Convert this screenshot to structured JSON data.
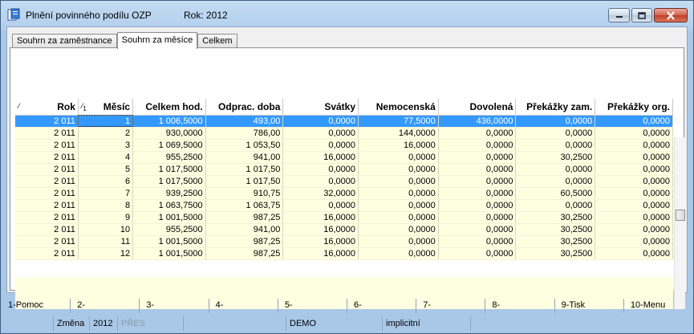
{
  "window": {
    "title": "Plnění povinného podílu OZP",
    "year_label": "Rok: 2012"
  },
  "tabs": [
    {
      "label": "Souhrn za zaměstnance",
      "active": false
    },
    {
      "label": "Souhrn za měsíce",
      "active": true
    },
    {
      "label": "Celkem",
      "active": false
    }
  ],
  "table": {
    "sort_markers": {
      "rok": "⁄",
      "mesic": "⁄"
    },
    "sort_index": "1",
    "columns": [
      "Rok",
      "Měsíc",
      "Celkem hod.",
      "Odprac. doba",
      "Svátky",
      "Nemocenská",
      "Dovolená",
      "Překážky zam.",
      "Překážky org."
    ],
    "rows": [
      [
        "2 011",
        "1",
        "1 006,5000",
        "493,00",
        "0,0000",
        "77,5000",
        "436,0000",
        "0,0000",
        "0,0000"
      ],
      [
        "2 011",
        "2",
        "930,0000",
        "786,00",
        "0,0000",
        "144,0000",
        "0,0000",
        "0,0000",
        "0,0000"
      ],
      [
        "2 011",
        "3",
        "1 069,5000",
        "1 053,50",
        "0,0000",
        "16,0000",
        "0,0000",
        "0,0000",
        "0,0000"
      ],
      [
        "2 011",
        "4",
        "955,2500",
        "941,00",
        "16,0000",
        "0,0000",
        "0,0000",
        "30,2500",
        "0,0000"
      ],
      [
        "2 011",
        "5",
        "1 017,5000",
        "1 017,50",
        "0,0000",
        "0,0000",
        "0,0000",
        "0,0000",
        "0,0000"
      ],
      [
        "2 011",
        "6",
        "1 017,5000",
        "1 017,50",
        "0,0000",
        "0,0000",
        "0,0000",
        "0,0000",
        "0,0000"
      ],
      [
        "2 011",
        "7",
        "939,2500",
        "910,75",
        "32,0000",
        "0,0000",
        "0,0000",
        "60,5000",
        "0,0000"
      ],
      [
        "2 011",
        "8",
        "1 063,7500",
        "1 063,75",
        "0,0000",
        "0,0000",
        "0,0000",
        "0,0000",
        "0,0000"
      ],
      [
        "2 011",
        "9",
        "1 001,5000",
        "987,25",
        "16,0000",
        "0,0000",
        "0,0000",
        "30,2500",
        "0,0000"
      ],
      [
        "2 011",
        "10",
        "955,2500",
        "941,00",
        "16,0000",
        "0,0000",
        "0,0000",
        "30,2500",
        "0,0000"
      ],
      [
        "2 011",
        "11",
        "1 001,5000",
        "987,25",
        "16,0000",
        "0,0000",
        "0,0000",
        "30,2500",
        "0,0000"
      ],
      [
        "2 011",
        "12",
        "1 001,5000",
        "987,25",
        "16,0000",
        "0,0000",
        "0,0000",
        "30,2500",
        "0,0000"
      ]
    ],
    "selected_row": 0
  },
  "function_keys": [
    "1-Pomoc",
    "2-",
    "3-",
    "4-",
    "5-",
    "6-",
    "7-",
    "8-",
    "9-Tisk",
    "10-Menu"
  ],
  "status": {
    "mode": "Změna",
    "year": "2012",
    "pres": "PŘES",
    "company": "DEMO",
    "profile": "implicitní"
  },
  "colors": {
    "selection": "#3399ff",
    "row_background": "#fefee1",
    "title_gradient": "#b5d1ee"
  },
  "icons": {
    "app": "document-app-icon",
    "minimize": "minimize-icon",
    "maximize": "maximize-icon",
    "close": "close-icon"
  }
}
